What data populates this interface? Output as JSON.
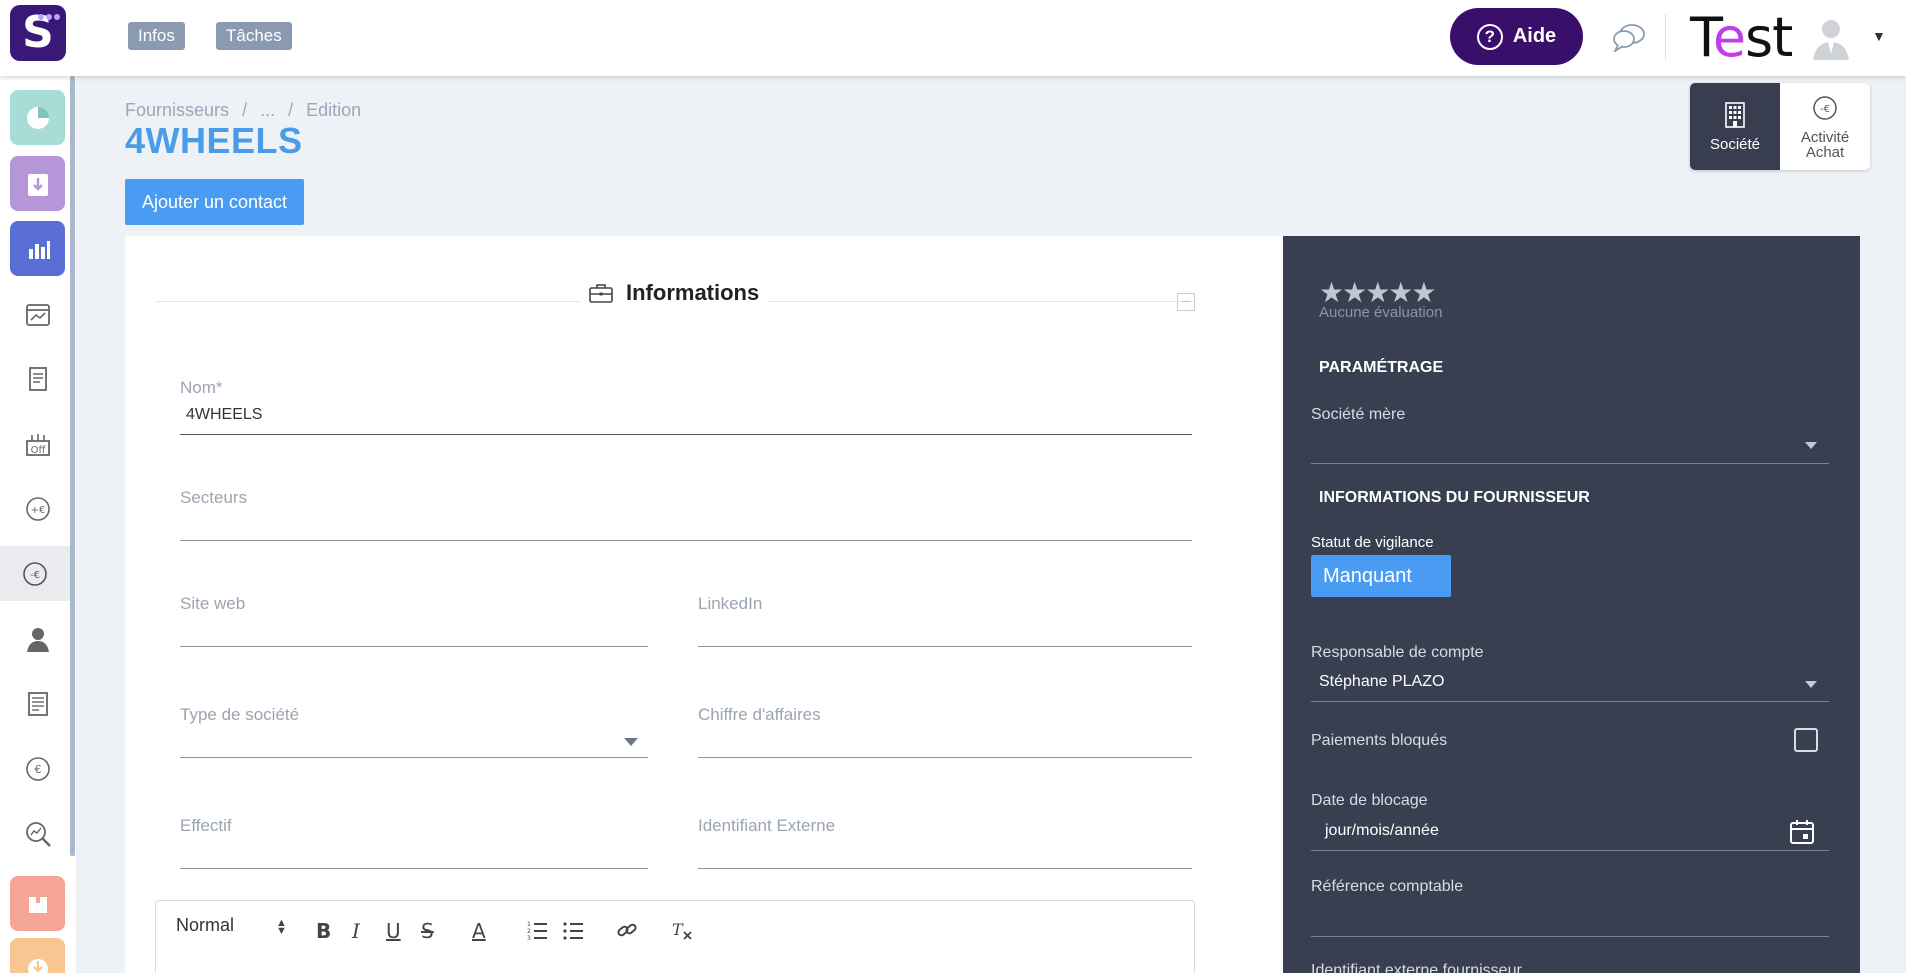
{
  "topbar": {
    "logo_letter": "S",
    "nav": [
      "Infos",
      "Tâches"
    ],
    "help_label": "Aide",
    "brand": {
      "t": "T",
      "e": "e",
      "rest": "st"
    },
    "colors": {
      "logo_bg": "#3a1877",
      "help_bg": "#3a0f6b",
      "brand_accent": "#c23ee6"
    }
  },
  "sidebar": {
    "items": [
      {
        "icon": "dashboard-icon"
      },
      {
        "icon": "inbox-icon"
      },
      {
        "icon": "bar-chart-icon"
      },
      {
        "icon": "calendar-chart-icon"
      },
      {
        "icon": "receipt-icon"
      },
      {
        "icon": "discount-icon"
      },
      {
        "icon": "plus-euro-icon"
      },
      {
        "icon": "minus-euro-icon"
      },
      {
        "icon": "contact-icon"
      },
      {
        "icon": "invoice-icon"
      },
      {
        "icon": "euro-coin-icon"
      },
      {
        "icon": "analytics-search-icon"
      },
      {
        "icon": "orange-box-icon"
      },
      {
        "icon": "orange-download-icon"
      }
    ]
  },
  "breadcrumb": [
    "Fournisseurs",
    "/",
    "...",
    "/",
    "Edition"
  ],
  "page_title": "4WHEELS",
  "add_contact_label": "Ajouter un contact",
  "view_switch": {
    "options": [
      {
        "label": "Société",
        "icon": "building-icon",
        "active": true
      },
      {
        "label_line1": "Activité",
        "label_line2": "Achat",
        "icon": "minus-euro-icon",
        "active": false
      }
    ]
  },
  "informations": {
    "title": "Informations",
    "collapse_symbol": "–",
    "fields": {
      "nom": {
        "label": "Nom*",
        "value": "4WHEELS"
      },
      "secteurs": {
        "label": "Secteurs",
        "value": ""
      },
      "site_web": {
        "label": "Site web",
        "value": ""
      },
      "linkedin": {
        "label": "LinkedIn",
        "value": ""
      },
      "type_societe": {
        "label": "Type de société",
        "value": ""
      },
      "chiffre_affaires": {
        "label": "Chiffre d'affaires",
        "value": ""
      },
      "effectif": {
        "label": "Effectif",
        "value": ""
      },
      "identifiant_externe": {
        "label": "Identifiant Externe",
        "value": ""
      }
    },
    "editor": {
      "format": "Normal",
      "buttons": {
        "bold": "B",
        "italic": "I",
        "underline": "U",
        "strike": "S",
        "color": "A"
      }
    }
  },
  "right_panel": {
    "stars": "★★★★★",
    "rating_label": "Aucune évaluation",
    "parametrage_heading": "PARAMÉTRAGE",
    "societe_mere_label": "Société mère",
    "societe_mere_value": "",
    "fournisseur_heading": "INFORMATIONS DU FOURNISSEUR",
    "vigilance_label": "Statut de vigilance",
    "vigilance_value": "Manquant",
    "responsable_label": "Responsable de compte",
    "responsable_value": "Stéphane PLAZO",
    "paiements_label": "Paiements bloqués",
    "paiements_checked": false,
    "date_blocage_label": "Date de blocage",
    "date_blocage_placeholder": "jour/mois/année",
    "reference_label": "Référence comptable",
    "reference_value": "",
    "identifiant_label": "Identifiant externe fournisseur",
    "colors": {
      "panel_bg": "#383f50",
      "badge_bg": "#4a9cf2"
    }
  }
}
